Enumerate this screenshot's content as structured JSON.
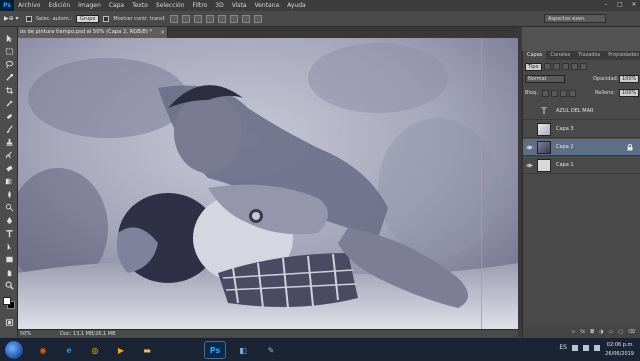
{
  "menu": {
    "logo": "Ps",
    "items": [
      "Archivo",
      "Edición",
      "Imagen",
      "Capa",
      "Texto",
      "Selección",
      "Filtro",
      "3D",
      "Vista",
      "Ventana",
      "Ayuda"
    ],
    "window_controls": [
      "–",
      "□",
      "✕"
    ]
  },
  "options_bar": {
    "tool_label": "▶⊕ ▾",
    "auto_select_label": "Selec. autom.:",
    "auto_select_target": "Grupo",
    "show_transform_label": "Mostrar contr. transf.",
    "workspace": "Aspectos esen."
  },
  "document": {
    "tab_title": "os de pintura tiempo.psd al 50% (Capa 2, RGB/8) *",
    "close_glyph": "×",
    "zoom": "50%",
    "doc_info": "Doc: 13,1 MB/26,1 MB"
  },
  "layers_panel": {
    "tabs": [
      "Capas",
      "Canales",
      "Trazados",
      "Propiedades"
    ],
    "filter_kind": "Tipo",
    "blend_mode": "Normal",
    "opacity_label": "Opacidad:",
    "opacity_value": "100%",
    "lock_label": "Bloq.:",
    "fill_label": "Relleno:",
    "fill_value": "100%",
    "layers": [
      {
        "name": "AZUL DEL MAR",
        "kind": "text",
        "visible": false,
        "selected": false
      },
      {
        "name": "Capa 3",
        "kind": "pixel",
        "visible": false,
        "selected": false
      },
      {
        "name": "Capa 2",
        "kind": "pixel",
        "visible": true,
        "selected": true,
        "locked": true
      },
      {
        "name": "Capa 1",
        "kind": "pixel",
        "visible": true,
        "selected": false
      }
    ],
    "footer_icons": [
      "link-icon",
      "fx-icon",
      "mask-icon",
      "adjustment-icon",
      "folder-icon",
      "new-layer-icon",
      "trash-icon"
    ]
  },
  "taskbar": {
    "pinned": [
      {
        "name": "firefox",
        "label": "◉",
        "color": "#e66000"
      },
      {
        "name": "internet-explorer",
        "label": "e",
        "color": "#1ea1f1"
      },
      {
        "name": "chrome",
        "label": "◎",
        "color": "#34a853"
      },
      {
        "name": "media-player",
        "label": "▶",
        "color": "#f7a21b"
      },
      {
        "name": "file-explorer",
        "label": "▬",
        "color": "#e8c35a"
      },
      {
        "name": "photoshop",
        "label": "Ps",
        "color": "#31a8ff"
      },
      {
        "name": "illustrator-like",
        "label": "◧",
        "color": "#7aa9d6"
      },
      {
        "name": "paint",
        "label": "✎",
        "color": "#9bb9d9"
      }
    ],
    "language": "ES",
    "time": "02:06 p.m.",
    "date": "26/06/2019"
  },
  "colors": {
    "panel_bg": "#4a4a4a",
    "selected_layer": "#5d6f85",
    "guide": "#22d4d4",
    "taskbar": "#1b2434"
  }
}
